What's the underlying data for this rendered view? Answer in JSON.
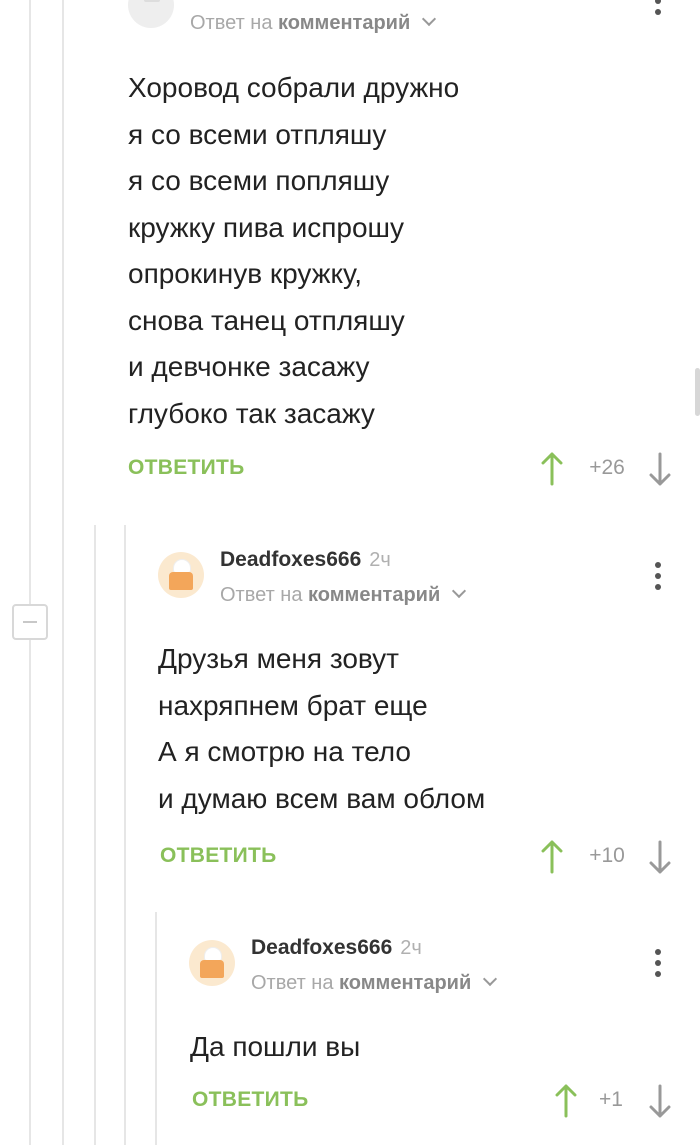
{
  "comments": [
    {
      "reply_prefix": "Ответ на",
      "reply_target": "комментарий",
      "lines": [
        "Хоровод собрали дружно",
        "я со всеми отпляшу",
        "я со всеми попляшу",
        "кружку пива испрошу",
        "опрокинув кружку,",
        "снова танец отпляшу",
        "и девчонке засажу",
        "глубоко так засажу"
      ],
      "reply_label": "ОТВЕТИТЬ",
      "score": "+26"
    },
    {
      "author": "Deadfoxes666",
      "time": "2ч",
      "reply_prefix": "Ответ на",
      "reply_target": "комментарий",
      "lines": [
        "Друзья меня зовут",
        "нахряпнем брат еще",
        "А я смотрю на тело",
        "и думаю всем вам облом"
      ],
      "reply_label": "ОТВЕТИТЬ",
      "score": "+10"
    },
    {
      "author": "Deadfoxes666",
      "time": "2ч",
      "reply_prefix": "Ответ на",
      "reply_target": "комментарий",
      "lines": [
        "Да пошли вы"
      ],
      "reply_label": "ОТВЕТИТЬ",
      "score": "+1"
    }
  ],
  "colors": {
    "accent_green": "#8ac05a",
    "thread_line": "#e6e6e6",
    "muted_text": "#a8a8a8"
  }
}
